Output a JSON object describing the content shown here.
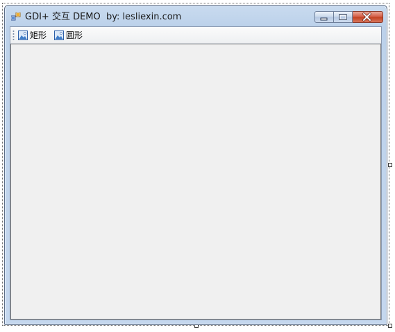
{
  "window": {
    "title": "GDI+ 交互 DEMO  by: lesliexin.com"
  },
  "toolbar": {
    "items": [
      {
        "label": "矩形",
        "icon": "image-icon"
      },
      {
        "label": "圆形",
        "icon": "image-icon"
      }
    ]
  },
  "caption_buttons": {
    "minimize": "minimize-icon",
    "maximize": "maximize-icon",
    "close": "close-icon"
  },
  "colors": {
    "title_bar": "#bcd1ea",
    "client_background": "#f0f0f0",
    "close_button": "#c2401f"
  }
}
